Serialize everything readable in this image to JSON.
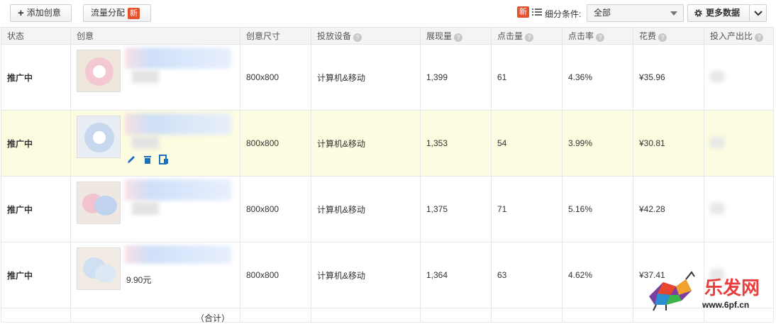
{
  "toolbar": {
    "add_creative_label": "添加创意",
    "traffic_label": "流量分配",
    "new_badge": "新",
    "filter_label": "细分条件:",
    "filter_value": "全部",
    "more_data_label": "更多数据"
  },
  "table": {
    "headers": {
      "status": "状态",
      "creative": "创意",
      "size": "创意尺寸",
      "device": "投放设备",
      "impressions": "展现量",
      "clicks": "点击量",
      "ctr": "点击率",
      "cost": "花费",
      "roi": "投入产出比"
    },
    "rows": [
      {
        "status": "推广中",
        "price": "",
        "size": "800x800",
        "device": "计算机&移动",
        "impressions": "1,399",
        "clicks": "61",
        "ctr": "4.36%",
        "cost": "¥35.96"
      },
      {
        "status": "推广中",
        "price": "",
        "size": "800x800",
        "device": "计算机&移动",
        "impressions": "1,353",
        "clicks": "54",
        "ctr": "3.99%",
        "cost": "¥30.81"
      },
      {
        "status": "推广中",
        "price": "",
        "size": "800x800",
        "device": "计算机&移动",
        "impressions": "1,375",
        "clicks": "71",
        "ctr": "5.16%",
        "cost": "¥42.28"
      },
      {
        "status": "推广中",
        "price": "9.90元",
        "size": "800x800",
        "device": "计算机&移动",
        "impressions": "1,364",
        "clicks": "63",
        "ctr": "4.62%",
        "cost": "¥37.41"
      }
    ],
    "total_label": "（合计）"
  },
  "watermark": {
    "brand": "乐发网",
    "url": "www.6pf.cn"
  },
  "colors": {
    "status_green": "#2e8b22",
    "badge_red": "#e5512d",
    "highlight_row": "#fcfce0",
    "action_blue": "#1f6fc0"
  }
}
